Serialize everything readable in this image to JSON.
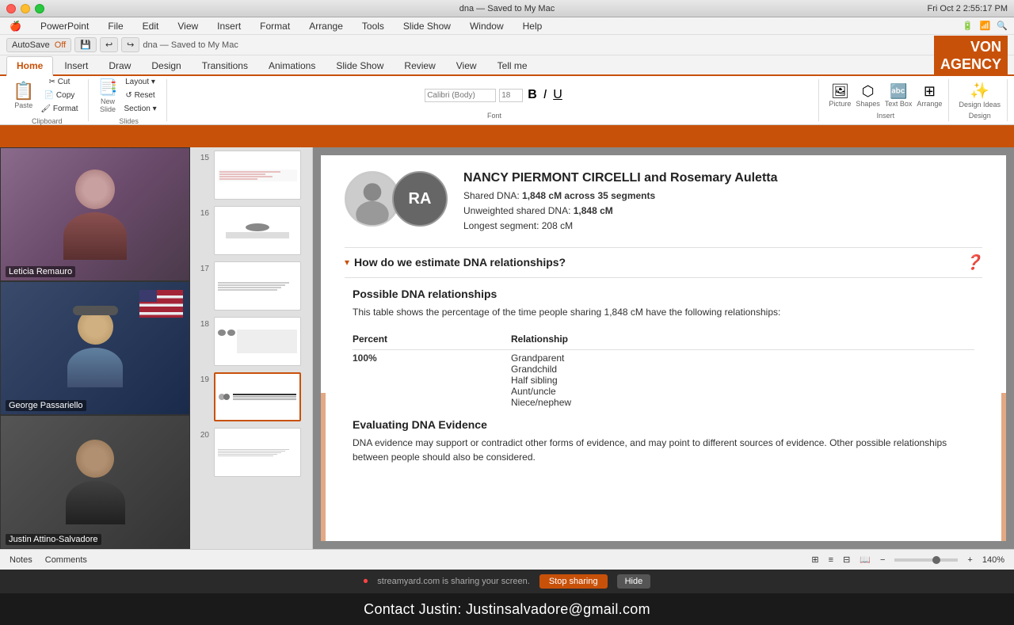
{
  "system": {
    "os": "macOS",
    "time": "Fri Oct 2 2:55:17 PM",
    "battery": "100%",
    "wifi": "on",
    "app": "PowerPoint"
  },
  "titlebar": {
    "doc_name": "dna — Saved to My Mac",
    "window_controls": [
      "close",
      "minimize",
      "maximize"
    ]
  },
  "menu": {
    "apple": "🍎",
    "items": [
      "PowerPoint",
      "File",
      "Edit",
      "View",
      "Insert",
      "Format",
      "Arrange",
      "Tools",
      "Slide Show",
      "Window",
      "Help"
    ]
  },
  "ribbon": {
    "tabs": [
      "Home",
      "Insert",
      "Draw",
      "Design",
      "Transitions",
      "Animations",
      "Slide Show",
      "Review",
      "View",
      "Tell me"
    ],
    "active_tab": "Home",
    "groups": {
      "clipboard": {
        "label": "Clipboard",
        "buttons": [
          "Paste",
          "Cut",
          "Copy",
          "Format"
        ]
      },
      "slides": {
        "label": "Slides",
        "buttons": [
          "New Slide",
          "Layout",
          "Reset",
          "Section"
        ]
      }
    }
  },
  "toolbar": {
    "autosave": "AutoSave",
    "autosave_state": "Off",
    "filename_display": "dna — Saved to My Mac"
  },
  "logo": {
    "line1": "VON",
    "line2": "AGENCY"
  },
  "participants": [
    {
      "name": "Leticia Remauro",
      "video": true
    },
    {
      "name": "George Passariello",
      "video": true,
      "has_flag": true
    },
    {
      "name": "Justin Attino-Salvadore",
      "video": true
    }
  ],
  "slides": [
    {
      "num": "15",
      "active": false
    },
    {
      "num": "16",
      "active": false
    },
    {
      "num": "17",
      "active": false
    },
    {
      "num": "18",
      "active": false
    },
    {
      "num": "19",
      "active": true
    },
    {
      "num": "20",
      "active": false
    }
  ],
  "slide_content": {
    "person1_initials": "RA",
    "title": "NANCY PIERMONT CIRCELLI and Rosemary Auletta",
    "shared_dna_label": "Shared DNA:",
    "shared_dna_value": "1,848 cM across",
    "segments": "35 segments",
    "unweighted_label": "Unweighted shared DNA:",
    "unweighted_value": "1,848 cM",
    "longest_label": "Longest segment:",
    "longest_value": "208 cM",
    "section_title": "How do we estimate DNA relationships?",
    "possible_title": "Possible DNA relationships",
    "possible_description": "This table shows the percentage of the time people sharing 1,848 cM have the following relationships:",
    "table_headers": [
      "Percent",
      "Relationship"
    ],
    "table_rows": [
      {
        "percent": "100%",
        "relationships": [
          "Grandparent",
          "Grandchild",
          "Half sibling",
          "Aunt/uncle",
          "Niece/nephew"
        ]
      }
    ],
    "evaluating_title": "Evaluating DNA Evidence",
    "evaluating_text": "DNA evidence may support or contradict other forms of evidence, and may point to different sources of evidence. Other possible relationships between people should also be considered."
  },
  "status_bar": {
    "notes": "Notes",
    "comments": "Comments",
    "view_icons": [
      "normal",
      "outline",
      "slide-sorter",
      "reading"
    ],
    "zoom": "140%",
    "zoom_minus": "−",
    "zoom_plus": "+"
  },
  "streaming": {
    "message": "streamyard.com is sharing your screen.",
    "stop_label": "Stop sharing",
    "hide_label": "Hide"
  },
  "contact_bar": {
    "text": "Contact Justin: Justinsalvadore@gmail.com"
  }
}
